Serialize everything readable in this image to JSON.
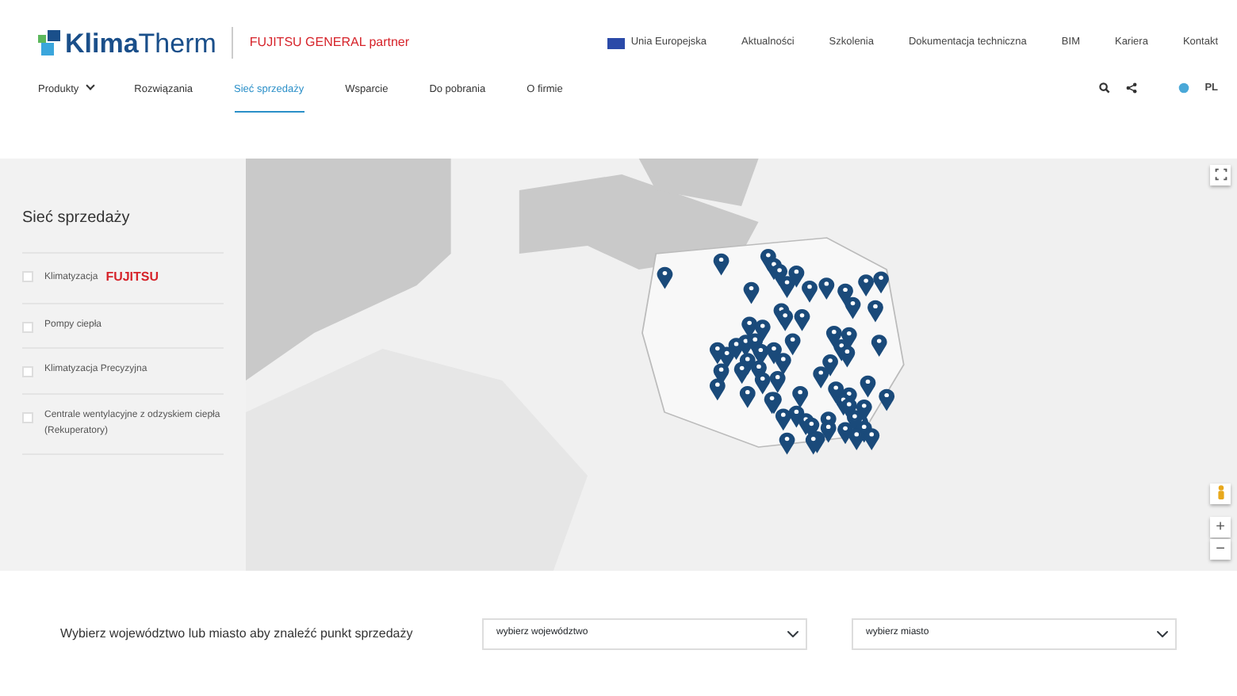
{
  "header": {
    "brand": {
      "bold": "Klima",
      "light": "Therm",
      "partner": "FUJITSU GENERAL partner"
    },
    "top_links": [
      {
        "label": "Unia Europejska",
        "flag": true
      },
      {
        "label": "Aktualności",
        "flag": false
      },
      {
        "label": "Szkolenia",
        "flag": false
      },
      {
        "label": "Dokumentacja techniczna",
        "flag": false
      },
      {
        "label": "BIM",
        "flag": false
      },
      {
        "label": "Kariera",
        "flag": false
      },
      {
        "label": "Kontakt",
        "flag": false
      }
    ],
    "nav": [
      {
        "label": "Produkty",
        "dropdown": true,
        "selected": false
      },
      {
        "label": "Rozwiązania",
        "dropdown": false,
        "selected": false
      },
      {
        "label": "Sieć sprzedaży",
        "dropdown": false,
        "selected": true
      },
      {
        "label": "Wsparcie",
        "dropdown": false,
        "selected": false
      },
      {
        "label": "Do pobrania",
        "dropdown": false,
        "selected": false
      },
      {
        "label": "O firmie",
        "dropdown": false,
        "selected": false
      }
    ],
    "language": "PL"
  },
  "sidebar": {
    "title": "Sieć sprzedaży",
    "filters": [
      {
        "label": "Klimatyzacja",
        "logo": "FUJITSU",
        "checked": false
      },
      {
        "label": "Pompy ciepła",
        "checked": false
      },
      {
        "label": "Klimatyzacja Precyzyjna",
        "checked": false
      },
      {
        "label": "Centrale wentylacyjne z odzyskiem ciepła (Rekuperatory)",
        "checked": false
      }
    ]
  },
  "map": {
    "zoom_in": "+",
    "zoom_out": "−"
  },
  "finder": {
    "prompt": "Wybierz województwo lub miasto aby znaleźć punkt sprzedaży",
    "selects": [
      {
        "value": "wybierz województwo"
      },
      {
        "value": "wybierz miasto"
      }
    ]
  }
}
